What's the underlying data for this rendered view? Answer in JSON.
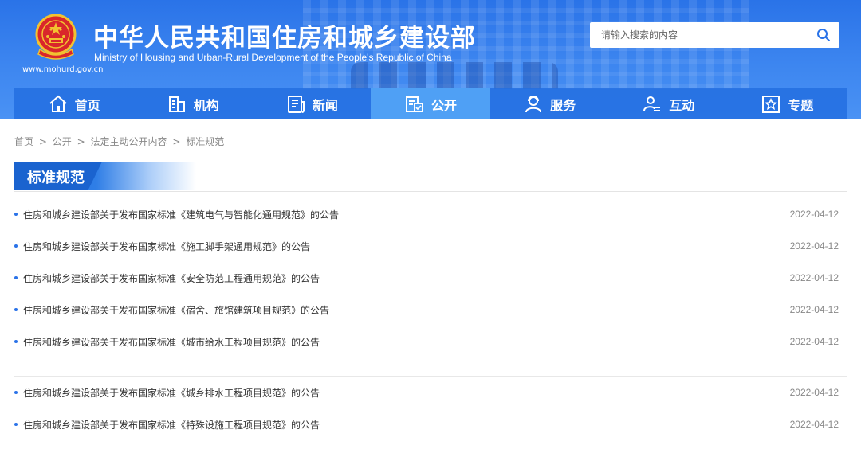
{
  "header": {
    "title_cn": "中华人民共和国住房和城乡建设部",
    "title_en": "Ministry of Housing and Urban-Rural Development of the People's Republic of China",
    "site_url": "www.mohurd.gov.cn",
    "emblem_icon": "national-emblem-icon"
  },
  "search": {
    "placeholder": "请输入搜索的内容",
    "value": "",
    "icon": "search-icon"
  },
  "nav": {
    "items": [
      {
        "label": "首页",
        "icon": "home-icon",
        "active": false
      },
      {
        "label": "机构",
        "icon": "building-icon",
        "active": false
      },
      {
        "label": "新闻",
        "icon": "news-icon",
        "active": false
      },
      {
        "label": "公开",
        "icon": "public-info-icon",
        "active": true
      },
      {
        "label": "服务",
        "icon": "service-icon",
        "active": false
      },
      {
        "label": "互动",
        "icon": "interaction-icon",
        "active": false
      },
      {
        "label": "专题",
        "icon": "star-topic-icon",
        "active": false
      }
    ]
  },
  "breadcrumb": [
    "首页",
    "公开",
    "法定主动公开内容",
    "标准规范"
  ],
  "breadcrumb_separator": ">",
  "section": {
    "title": "标准规范"
  },
  "list": {
    "group1": [
      {
        "title": "住房和城乡建设部关于发布国家标准《建筑电气与智能化通用规范》的公告",
        "date": "2022-04-12"
      },
      {
        "title": "住房和城乡建设部关于发布国家标准《施工脚手架通用规范》的公告",
        "date": "2022-04-12"
      },
      {
        "title": "住房和城乡建设部关于发布国家标准《安全防范工程通用规范》的公告",
        "date": "2022-04-12"
      },
      {
        "title": "住房和城乡建设部关于发布国家标准《宿舍、旅馆建筑项目规范》的公告",
        "date": "2022-04-12"
      },
      {
        "title": "住房和城乡建设部关于发布国家标准《城市给水工程项目规范》的公告",
        "date": "2022-04-12"
      }
    ],
    "group2": [
      {
        "title": "住房和城乡建设部关于发布国家标准《城乡排水工程项目规范》的公告",
        "date": "2022-04-12"
      },
      {
        "title": "住房和城乡建设部关于发布国家标准《特殊设施工程项目规范》的公告",
        "date": "2022-04-12"
      }
    ]
  },
  "colors": {
    "header_blue": "#2a73e8",
    "nav_active": "#4fa0f5",
    "section_tab": "#1f6fde",
    "bullet": "#2a73e8"
  }
}
